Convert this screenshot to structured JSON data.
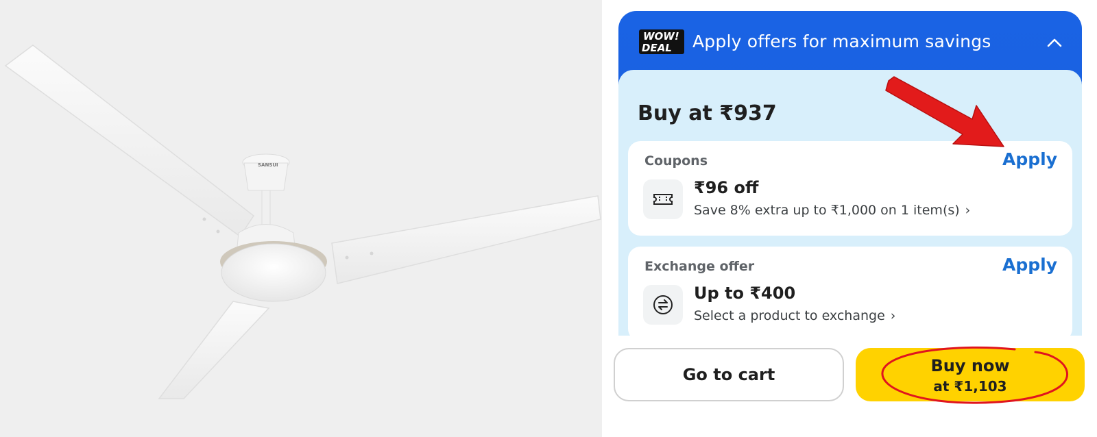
{
  "product": {
    "brand_text": "SANSUI"
  },
  "offers_panel": {
    "badge": {
      "line1": "WOW!",
      "line2": "DEAL"
    },
    "title": "Apply offers for maximum savings",
    "buy_at": "Buy at ₹937",
    "coupons": {
      "label": "Coupons",
      "apply_label": "Apply",
      "amount": "₹96 off",
      "description": "Save 8% extra up to ₹1,000 on 1 item(s)",
      "icon": "coupon-ticket-icon"
    },
    "exchange": {
      "label": "Exchange offer",
      "apply_label": "Apply",
      "amount": "Up to ₹400",
      "description": "Select a product to exchange",
      "icon": "exchange-arrows-icon"
    }
  },
  "actions": {
    "cart_label": "Go to cart",
    "buy_label": "Buy now",
    "buy_price": "at ₹1,103"
  },
  "colors": {
    "header_blue": "#1a63e4",
    "body_light_blue": "#d8effb",
    "apply_blue": "#1a6fd1",
    "buy_yellow": "#ffd200",
    "annotation_red": "#e0141e"
  }
}
